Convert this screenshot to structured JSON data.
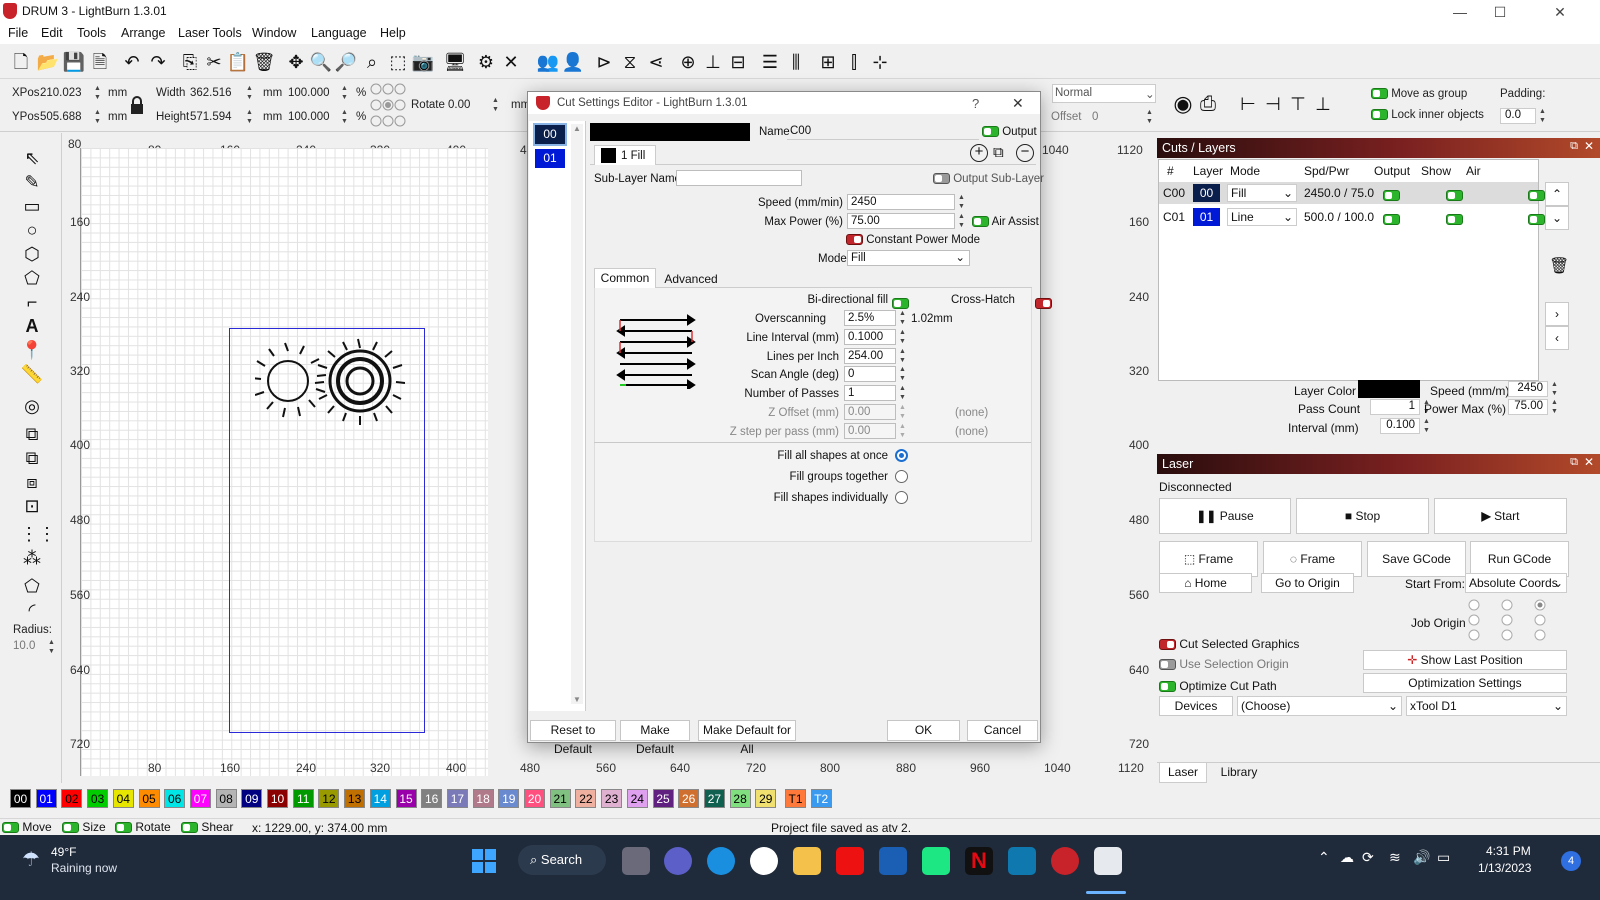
{
  "window": {
    "title": "DRUM 3 - LightBurn 1.3.01",
    "min": "—",
    "max": "☐",
    "close": "✕"
  },
  "menu": [
    "File",
    "Edit",
    "Tools",
    "Arrange",
    "Laser Tools",
    "Window",
    "Language",
    "Help"
  ],
  "numbar": {
    "xpos_label": "XPos",
    "xpos": "210.023",
    "ypos_label": "YPos",
    "ypos": "505.688",
    "unit": "mm",
    "width_label": "Width",
    "width": "362.516",
    "height_label": "Height",
    "height": "571.594",
    "scale_x": "100.000",
    "scale_y": "100.000",
    "pct": "%",
    "rotate_label": "Rotate",
    "rotate": "0.00",
    "unit2": "mm",
    "normal": "Normal",
    "offset_label": "Offset",
    "offset": "0",
    "move_group": "Move as group",
    "lock_inner": "Lock inner objects",
    "padding_label": "Padding:",
    "padding": "0.0"
  },
  "tools": {
    "radius_label": "Radius:",
    "radius": "10.0",
    "text_tool": "A"
  },
  "rulers": {
    "top": [
      "80",
      "160",
      "240",
      "320",
      "400",
      "4",
      "1040",
      "1120"
    ],
    "left": [
      "80",
      "160",
      "240",
      "320",
      "400",
      "480",
      "560",
      "640",
      "720"
    ],
    "bottom": [
      "80",
      "160",
      "240",
      "320",
      "400",
      "480",
      "560",
      "640",
      "720",
      "800",
      "880",
      "960",
      "1040",
      "1120"
    ],
    "right": [
      "160",
      "240",
      "320",
      "400",
      "480",
      "560",
      "640",
      "720"
    ]
  },
  "dialog": {
    "title": "Cut Settings Editor - LightBurn 1.3.01",
    "help": "?",
    "close": "✕",
    "layers": [
      "00",
      "01"
    ],
    "name_label": "Name",
    "name": "C00",
    "output_label": "Output",
    "sublayer_tab": "1 Fill",
    "sublayer_name_label": "Sub-Layer Name",
    "sublayer_name": "",
    "output_sublayer": "Output Sub-Layer",
    "speed_label": "Speed (mm/min)",
    "speed": "2450",
    "maxpower_label": "Max Power (%)",
    "maxpower": "75.00",
    "air_assist": "Air Assist",
    "constant_power": "Constant Power Mode",
    "mode_label": "Mode",
    "mode": "Fill",
    "tabs": [
      "Common",
      "Advanced"
    ],
    "bidir_label": "Bi-directional fill",
    "crosshatch_label": "Cross-Hatch",
    "overscan_label": "Overscanning",
    "overscan": "2.5%",
    "overscan_mm": "1.02mm",
    "interval_label": "Line Interval (mm)",
    "interval": "0.1000",
    "lpi_label": "Lines per Inch",
    "lpi": "254.00",
    "angle_label": "Scan Angle (deg)",
    "angle": "0",
    "passes_label": "Number of Passes",
    "passes": "1",
    "zoffset_label": "Z Offset (mm)",
    "zoffset": "0.00",
    "zoffset_none": "(none)",
    "zstep_label": "Z step per pass (mm)",
    "zstep": "0.00",
    "zstep_none": "(none)",
    "fill_all": "Fill all shapes at once",
    "fill_groups": "Fill groups together",
    "fill_indiv": "Fill shapes individually",
    "reset": "Reset to Default",
    "make_default": "Make Default",
    "make_default_all": "Make Default for All",
    "ok": "OK",
    "cancel": "Cancel"
  },
  "cuts": {
    "title": "Cuts / Layers",
    "headers": [
      "#",
      "Layer",
      "Mode",
      "Spd/Pwr",
      "Output",
      "Show",
      "Air"
    ],
    "rows": [
      {
        "id": "C00",
        "layer": "00",
        "mode": "Fill",
        "spdpwr": "2450.0 / 75.0",
        "color": "#0b1f4d"
      },
      {
        "id": "C01",
        "layer": "01",
        "mode": "Line",
        "spdpwr": "500.0 / 100.0",
        "color": "#0019d6"
      }
    ],
    "layer_color_label": "Layer Color",
    "speed_label": "Speed (mm/m)",
    "speed": "2450",
    "pass_label": "Pass Count",
    "pass": "1",
    "power_label": "Power Max (%)",
    "power": "75.00",
    "interval_label": "Interval (mm)",
    "interval": "0.100"
  },
  "laser": {
    "title": "Laser",
    "status": "Disconnected",
    "pause": "Pause",
    "stop": "Stop",
    "start": "Start",
    "frame1": "Frame",
    "frame2": "Frame",
    "save_gcode": "Save GCode",
    "run_gcode": "Run GCode",
    "home": "Home",
    "go_origin": "Go to Origin",
    "start_from_label": "Start From:",
    "start_from": "Absolute Coords",
    "job_origin": "Job Origin",
    "cut_selected": "Cut Selected Graphics",
    "use_selection": "Use Selection Origin",
    "optimize": "Optimize Cut Path",
    "show_last": "Show Last Position",
    "opt_settings": "Optimization Settings",
    "devices": "Devices",
    "choose": "(Choose)",
    "device": "xTool D1",
    "tabs": [
      "Laser",
      "Library"
    ]
  },
  "palette": [
    {
      "l": "00",
      "c": "#000000",
      "t": "#fff"
    },
    {
      "l": "01",
      "c": "#0000ff",
      "t": "#fff"
    },
    {
      "l": "02",
      "c": "#ff0000",
      "t": "#000"
    },
    {
      "l": "03",
      "c": "#00cc00",
      "t": "#000"
    },
    {
      "l": "04",
      "c": "#e6e600",
      "t": "#000"
    },
    {
      "l": "05",
      "c": "#ff8c00",
      "t": "#000"
    },
    {
      "l": "06",
      "c": "#00e5e5",
      "t": "#000"
    },
    {
      "l": "07",
      "c": "#ff00ff",
      "t": "#fff"
    },
    {
      "l": "08",
      "c": "#b4b4b4",
      "t": "#000"
    },
    {
      "l": "09",
      "c": "#000080",
      "t": "#fff"
    },
    {
      "l": "10",
      "c": "#8b0000",
      "t": "#fff"
    },
    {
      "l": "11",
      "c": "#009900",
      "t": "#fff"
    },
    {
      "l": "12",
      "c": "#999900",
      "t": "#000"
    },
    {
      "l": "13",
      "c": "#c07000",
      "t": "#000"
    },
    {
      "l": "14",
      "c": "#00a0e0",
      "t": "#fff"
    },
    {
      "l": "15",
      "c": "#9900aa",
      "t": "#fff"
    },
    {
      "l": "16",
      "c": "#808080",
      "t": "#fff"
    },
    {
      "l": "17",
      "c": "#7a7ab8",
      "t": "#fff"
    },
    {
      "l": "18",
      "c": "#b07a8a",
      "t": "#fff"
    },
    {
      "l": "19",
      "c": "#6a8ad0",
      "t": "#fff"
    },
    {
      "l": "20",
      "c": "#ff5080",
      "t": "#fff"
    },
    {
      "l": "21",
      "c": "#80c080",
      "t": "#000"
    },
    {
      "l": "22",
      "c": "#f0b0a0",
      "t": "#000"
    },
    {
      "l": "23",
      "c": "#e0b0d0",
      "t": "#000"
    },
    {
      "l": "24",
      "c": "#e0a0f0",
      "t": "#000"
    },
    {
      "l": "25",
      "c": "#602080",
      "t": "#fff"
    },
    {
      "l": "26",
      "c": "#d07030",
      "t": "#fff"
    },
    {
      "l": "27",
      "c": "#106050",
      "t": "#fff"
    },
    {
      "l": "28",
      "c": "#80e080",
      "t": "#000"
    },
    {
      "l": "29",
      "c": "#f0e070",
      "t": "#000"
    },
    {
      "l": "T1",
      "c": "#ff7a3a",
      "t": "#000"
    },
    {
      "l": "T2",
      "c": "#3a9af0",
      "t": "#fff"
    }
  ],
  "status": {
    "move": "Move",
    "size": "Size",
    "rotate": "Rotate",
    "shear": "Shear",
    "coords": "x: 1229.00, y: 374.00 mm",
    "message": "Project file saved as atv 2."
  },
  "taskbar": {
    "temp": "49°F",
    "weather": "Raining now",
    "search": "Search",
    "time": "4:31 PM",
    "date": "1/13/2023",
    "notif": "4"
  }
}
